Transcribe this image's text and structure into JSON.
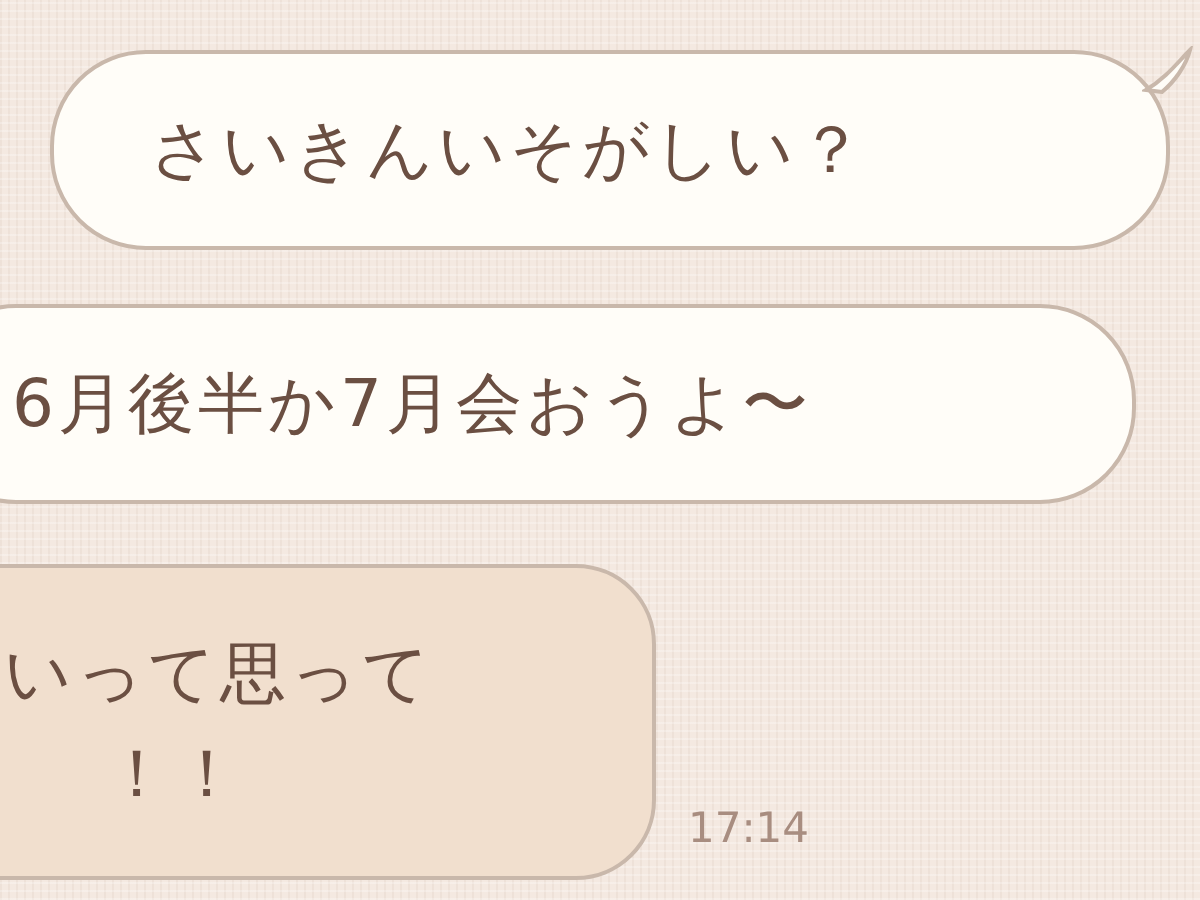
{
  "messages": [
    {
      "kind": "mine",
      "text": "さいきんいそがしい？",
      "tail": true
    },
    {
      "kind": "mine",
      "text": "6月後半か7月会おうよ〜",
      "tail": false
    },
    {
      "kind": "theirs",
      "lines": [
        "いって思って",
        "！！"
      ],
      "time": "17:14"
    }
  ]
}
